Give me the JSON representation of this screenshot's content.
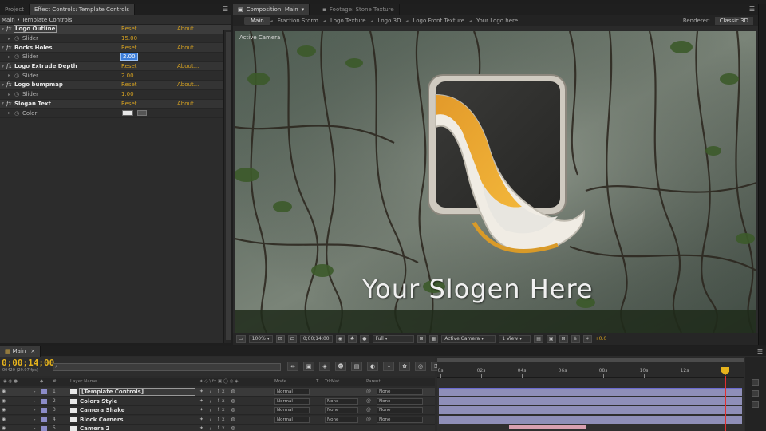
{
  "left_panel": {
    "tabs": [
      {
        "label": "Project"
      },
      {
        "label": "Effect Controls: Template Controls"
      }
    ],
    "breadcrumb": "Main • Template Controls",
    "effects": [
      {
        "name": "Logo Outline",
        "reset": "Reset",
        "about": "About...",
        "param": "Slider",
        "value": "15.00",
        "boxed": true
      },
      {
        "name": "Rocks Holes",
        "reset": "Reset",
        "about": "About...",
        "param": "Slider",
        "value": "2.00",
        "editing": true
      },
      {
        "name": "Logo Extrude Depth",
        "reset": "Reset",
        "about": "About...",
        "param": "Slider",
        "value": "2.00"
      },
      {
        "name": "Logo bumpmap",
        "reset": "Reset",
        "about": "About...",
        "param": "Slider",
        "value": "1.00"
      },
      {
        "name": "Slogan Text",
        "reset": "Reset",
        "about": "About...",
        "param": "Color",
        "value": ""
      }
    ],
    "fx_badge": "fx"
  },
  "comp_panel": {
    "tabs": [
      {
        "label": "Composition: Main"
      },
      {
        "label": "Footage: Stone Texture"
      }
    ],
    "flowchart": [
      "Main",
      "Fraction Storm",
      "Logo Texture",
      "Logo 3D",
      "Logo Front Texture",
      "Your Logo here"
    ],
    "renderer_label": "Renderer:",
    "renderer_value": "Classic 3D",
    "active_camera_label": "Active Camera",
    "slogan": "Your Slogen Here",
    "footer": {
      "zoom": "100%",
      "timecode": "0;00;14;00",
      "resolution": "Full",
      "camera": "Active Camera",
      "views": "1 View",
      "exposure": "+0.0"
    }
  },
  "timeline": {
    "tab": "Main",
    "timecode": "0;00;14;00",
    "fps": "00420 (29.97 fps)",
    "columns": {
      "layer_name": "Layer Name",
      "mode": "Mode",
      "trkmat": "TrkMat",
      "parent": "Parent"
    },
    "ruler_labels": [
      "0s",
      "02s",
      "04s",
      "06s",
      "08s",
      "10s",
      "12s"
    ],
    "cti_seconds": 14,
    "duration_seconds": 14,
    "layers": [
      {
        "num": "1",
        "name": "[Template Controls]",
        "mode": "Normal",
        "trkmat": "",
        "parent": "None",
        "selected": true
      },
      {
        "num": "2",
        "name": "Colors Style",
        "mode": "Normal",
        "trkmat": "None",
        "parent": "None"
      },
      {
        "num": "3",
        "name": "Camera Shake",
        "mode": "Normal",
        "trkmat": "None",
        "parent": "None"
      },
      {
        "num": "4",
        "name": "Block Corners",
        "mode": "Normal",
        "trkmat": "None",
        "parent": "None"
      },
      {
        "num": "5",
        "name": "Camera 2",
        "mode": "",
        "trkmat": "",
        "parent": ""
      }
    ]
  },
  "colors": {
    "accent_yellow": "#d4a021",
    "timecode_yellow": "#e6b31c",
    "layer_bar": "#8f8fb8",
    "cti_red": "#e03030"
  }
}
